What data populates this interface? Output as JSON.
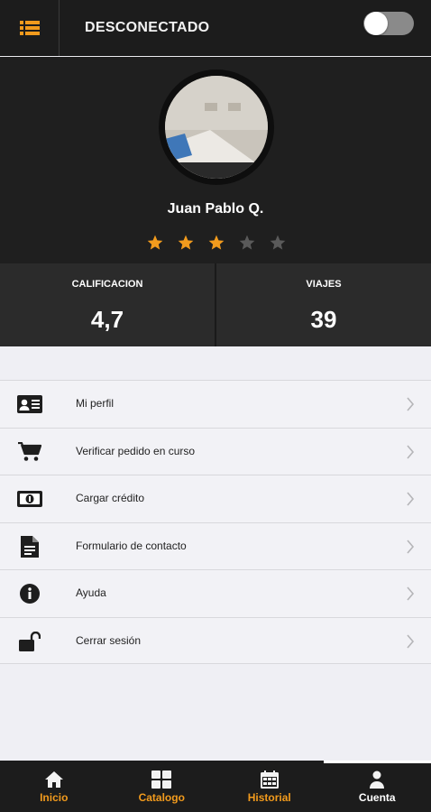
{
  "topbar": {
    "status": "DESCONECTADO",
    "toggle_on": false
  },
  "profile": {
    "name": "Juan Pablo Q.",
    "rating_stars": 3,
    "max_stars": 5
  },
  "stats": {
    "rating_label": "CALIFICACION",
    "rating_value": "4,7",
    "trips_label": "VIAJES",
    "trips_value": "39"
  },
  "menu": {
    "items": [
      {
        "label": "Mi perfil",
        "icon": "id-card-icon"
      },
      {
        "label": "Verificar pedido en curso",
        "icon": "cart-icon"
      },
      {
        "label": "Cargar crédito",
        "icon": "banknote-icon"
      },
      {
        "label": "Formulario de contacto",
        "icon": "document-icon"
      },
      {
        "label": "Ayuda",
        "icon": "info-icon"
      },
      {
        "label": "Cerrar sesión",
        "icon": "unlock-icon"
      }
    ]
  },
  "nav": {
    "items": [
      {
        "label": "Inicio",
        "icon": "home-icon"
      },
      {
        "label": "Catalogo",
        "icon": "grid-icon"
      },
      {
        "label": "Historial",
        "icon": "calendar-icon"
      },
      {
        "label": "Cuenta",
        "icon": "user-icon"
      }
    ],
    "active_index": 3
  },
  "colors": {
    "accent": "#f29b1d",
    "dark": "#1c1c1c",
    "star_off": "#5a5a5a",
    "background": "#efeff4"
  }
}
